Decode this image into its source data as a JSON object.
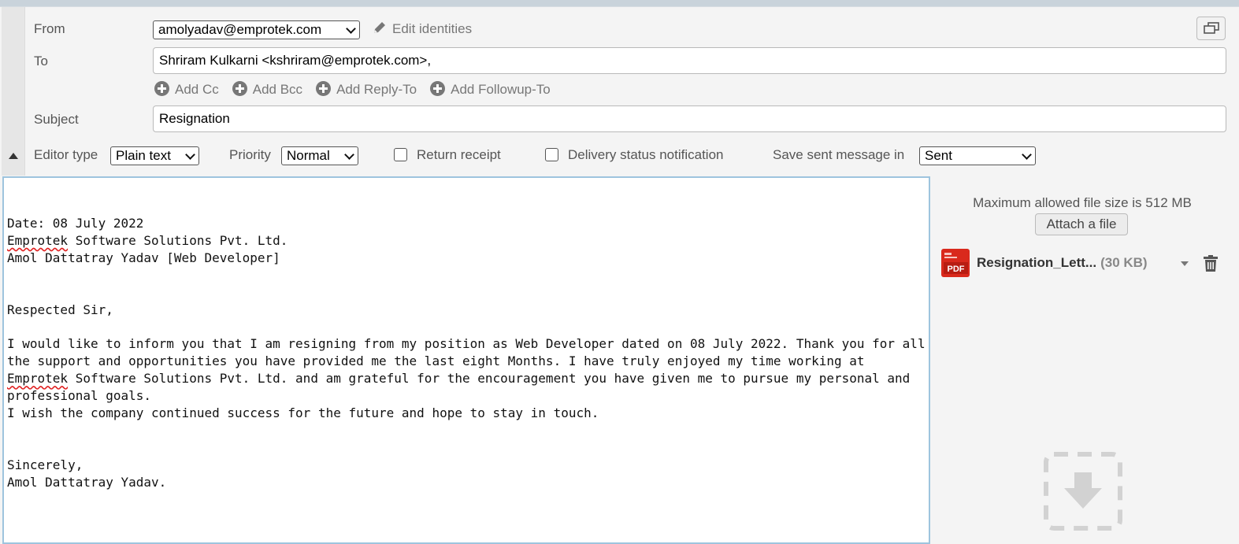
{
  "compose": {
    "from_label": "From",
    "from_value": "amolyadav@emprotek.com",
    "edit_identities": "Edit identities",
    "to_label": "To",
    "to_value": "Shriram Kulkarni <kshriram@emprotek.com>,",
    "add_links": [
      "Add Cc",
      "Add Bcc",
      "Add Reply-To",
      "Add Followup-To"
    ],
    "subject_label": "Subject",
    "subject_value": "Resignation",
    "editor_type_label": "Editor type",
    "editor_type_value": "Plain text",
    "priority_label": "Priority",
    "priority_value": "Normal",
    "return_receipt_label": "Return receipt",
    "delivery_status_label": "Delivery status notification",
    "save_sent_label": "Save sent message in",
    "save_sent_value": "Sent"
  },
  "body": {
    "date_prefix": "Date: 08",
    "date_suffix": " July 2022",
    "company_word": "Emprotek",
    "company_rest": " Software Solutions Pvt. Ltd.",
    "author_line": "Amol Dattatray Yadav [Web Developer]",
    "greeting": "Respected Sir,",
    "para_part1": "I would like to inform you that I am resigning from my position as Web Developer dated on 08 July 2022. Thank you for all the support and opportunities you have provided me the last eight Months. I have truly enjoyed my time working at ",
    "para_company": "Emprotek",
    "para_part2": " Software Solutions Pvt. Ltd. and am grateful for the encouragement you have given me to pursue my personal and professional goals.",
    "wish_line": "I wish the company continued success for the future and hope to stay in touch.",
    "closing": "Sincerely,",
    "signature": "Amol Dattatray Yadav."
  },
  "attachments": {
    "max_size_text": "Maximum allowed file size is 512 MB",
    "attach_button": "Attach a file",
    "file_name": "Resignation_Lett...",
    "file_size": "(30 KB)",
    "file_icon_text": "PDF"
  },
  "colors": {
    "editor_border": "#9ec4de",
    "pdf_red": "#d9291c",
    "spell_underline": "#e02020"
  }
}
